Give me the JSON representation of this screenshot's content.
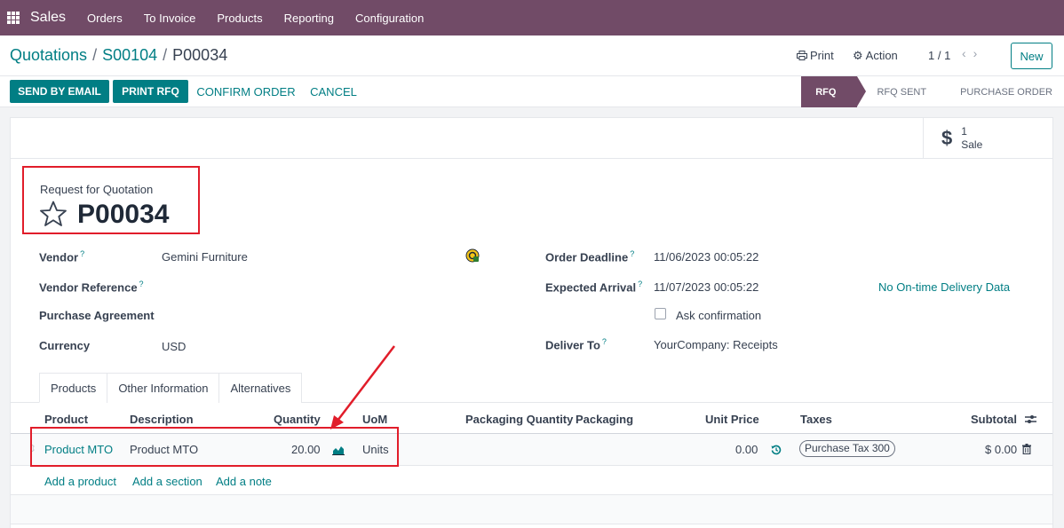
{
  "nav": {
    "brand": "Sales",
    "menu": [
      "Orders",
      "To Invoice",
      "Products",
      "Reporting",
      "Configuration"
    ]
  },
  "breadcrumb": {
    "root": "Quotations",
    "parent": "S00104",
    "current": "P00034"
  },
  "control": {
    "print": "Print",
    "action": "Action",
    "pager": "1 / 1",
    "new": "New"
  },
  "buttons": {
    "send_email": "SEND BY EMAIL",
    "print_rfq": "PRINT RFQ",
    "confirm": "CONFIRM ORDER",
    "cancel": "CANCEL"
  },
  "stages": [
    "RFQ",
    "RFQ SENT",
    "PURCHASE ORDER"
  ],
  "smart_button": {
    "count": "1",
    "label": "Sale"
  },
  "title": {
    "label": "Request for Quotation",
    "name": "P00034"
  },
  "fields": {
    "vendor_label": "Vendor",
    "vendor_value": "Gemini Furniture",
    "vendor_ref_label": "Vendor Reference",
    "agreement_label": "Purchase Agreement",
    "currency_label": "Currency",
    "currency_value": "USD",
    "deadline_label": "Order Deadline",
    "deadline_value": "11/06/2023 00:05:22",
    "arrival_label": "Expected Arrival",
    "arrival_value": "11/07/2023 00:05:22",
    "ontime_link": "No On-time Delivery Data",
    "ask_confirmation": "Ask confirmation",
    "deliver_label": "Deliver To",
    "deliver_value": "YourCompany: Receipts",
    "help_mark": "?"
  },
  "tabs": [
    "Products",
    "Other Information",
    "Alternatives"
  ],
  "table": {
    "headers": [
      "Product",
      "Description",
      "Quantity",
      "UoM",
      "Packaging Quantity",
      "Packaging",
      "Unit Price",
      "Taxes",
      "Subtotal"
    ],
    "row": {
      "product": "Product MTO",
      "description": "Product MTO",
      "quantity": "20.00",
      "uom": "Units",
      "unit_price": "0.00",
      "tax": "Purchase Tax 300",
      "subtotal": "$ 0.00"
    },
    "add_links": [
      "Add a product",
      "Add a section",
      "Add a note"
    ]
  },
  "colors": {
    "brand": "#714b67",
    "accent": "#017e84",
    "annotation": "#e11d2a"
  }
}
